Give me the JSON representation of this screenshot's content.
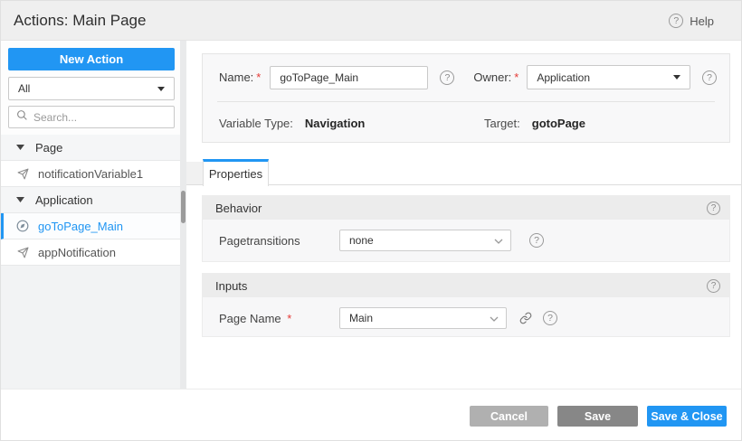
{
  "icons": {
    "question_glyph": "?"
  },
  "header": {
    "title": "Actions: Main Page",
    "help_label": "Help"
  },
  "sidebar": {
    "new_action_label": "New Action",
    "filter_value": "All",
    "search_placeholder": "Search...",
    "tree": [
      {
        "type": "group",
        "label": "Page"
      },
      {
        "type": "item",
        "label": "notificationVariable1"
      },
      {
        "type": "group",
        "label": "Application"
      },
      {
        "type": "item",
        "label": "goToPage_Main",
        "selected": true
      },
      {
        "type": "item",
        "label": "appNotification"
      }
    ]
  },
  "form": {
    "required_mark": "*",
    "name_label": "Name:",
    "name_value": "goToPage_Main",
    "owner_label": "Owner:",
    "owner_value": "Application",
    "variable_type_label": "Variable Type:",
    "variable_type_value": "Navigation",
    "target_label": "Target:",
    "target_value": "gotoPage"
  },
  "tabs": {
    "properties": "Properties"
  },
  "behavior": {
    "title": "Behavior",
    "pagetransitions_label": "Pagetransitions",
    "pagetransitions_value": "none"
  },
  "inputs": {
    "title": "Inputs",
    "page_name_label": "Page Name",
    "page_name_value": "Main"
  },
  "footer": {
    "cancel": "Cancel",
    "save": "Save",
    "save_close": "Save & Close"
  },
  "colors": {
    "accent": "#2196f3",
    "selected_text": "#2196f3",
    "cancel_gray": "#b0b0b0",
    "save_gray": "#878787",
    "required_red": "#e53935"
  }
}
